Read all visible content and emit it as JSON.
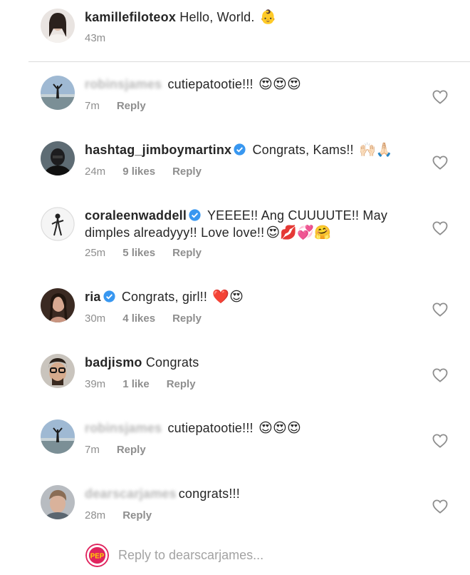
{
  "caption": {
    "username": "kamillefiloteox",
    "text": "Hello, World.",
    "emoji": "👶",
    "time": "43m"
  },
  "comments": [
    {
      "username": "robinsjames",
      "username_blurred": true,
      "verified": false,
      "text": "cutiepatootie!!!",
      "emoji": "😍😍😍",
      "time": "7m",
      "likes": "",
      "reply_label": "Reply"
    },
    {
      "username": "hashtag_jimboymartinx",
      "username_blurred": false,
      "verified": true,
      "text": "Congrats, Kams!!",
      "emoji": "🙌🏻🙏🏻",
      "time": "24m",
      "likes": "9 likes",
      "reply_label": "Reply"
    },
    {
      "username": "coraleenwaddell",
      "username_blurred": false,
      "verified": true,
      "text": "YEEEE!! Ang CUUUUTE!! May",
      "text_line2": "dimples alreadyyy!! Love love!!",
      "emoji": "😍💋💞🤗",
      "time": "25m",
      "likes": "5 likes",
      "reply_label": "Reply"
    },
    {
      "username": "ria",
      "username_blurred": false,
      "verified": true,
      "text": "Congrats, girl!!",
      "emoji": "❤️😍",
      "time": "30m",
      "likes": "4 likes",
      "reply_label": "Reply"
    },
    {
      "username": "badjismo",
      "username_blurred": false,
      "verified": false,
      "text": "Congrats",
      "emoji": "",
      "time": "39m",
      "likes": "1 like",
      "reply_label": "Reply"
    },
    {
      "username": "robinsjames",
      "username_blurred": true,
      "verified": false,
      "text": "cutiepatootie!!!",
      "emoji": "😍😍😍",
      "time": "7m",
      "likes": "",
      "reply_label": "Reply"
    },
    {
      "username": "dearscarjames",
      "username_blurred": true,
      "verified": false,
      "text": "congrats!!!",
      "emoji": "",
      "time": "28m",
      "likes": "",
      "reply_label": "Reply"
    }
  ],
  "reply_bar": {
    "placeholder": "Reply to dearscarjames...",
    "logo_text": "PEP"
  },
  "colors": {
    "text": "#262626",
    "secondary": "#8e8e8e",
    "verified": "#3897f0",
    "divider": "#dbdbdb",
    "heart_outline": "#8e8e8e"
  }
}
